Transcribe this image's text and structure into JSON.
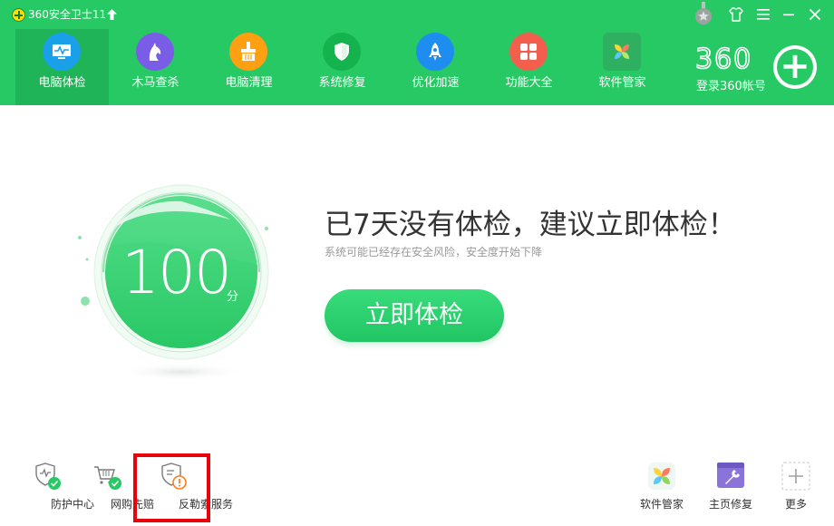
{
  "titlebar": {
    "app_title": "360安全卫士11"
  },
  "nav": {
    "items": [
      {
        "label": "电脑体检",
        "icon": "monitor-icon",
        "color": "#1aa0e8",
        "active": true
      },
      {
        "label": "木马查杀",
        "icon": "horse-icon",
        "color": "#7a5de6"
      },
      {
        "label": "电脑清理",
        "icon": "broom-icon",
        "color": "#ff9f12"
      },
      {
        "label": "系统修复",
        "icon": "shield-icon",
        "color": "#14b34e"
      },
      {
        "label": "优化加速",
        "icon": "rocket-icon",
        "color": "#1d8ef0"
      },
      {
        "label": "功能大全",
        "icon": "grid-icon",
        "color": "#f2604d"
      },
      {
        "label": "软件管家",
        "icon": "flower-icon",
        "color": "#2fb060"
      }
    ]
  },
  "account": {
    "brand": "360",
    "label": "登录360帐号"
  },
  "score": {
    "value": "100",
    "unit": "分"
  },
  "main": {
    "headline": "已7天没有体检，建议立即体检！",
    "subline": "系统可能已经存在安全风险，安全度开始下降",
    "check_button": "立即体检"
  },
  "tools_left": [
    {
      "label": "防护中心",
      "icon": "shield-check-icon"
    },
    {
      "label": "网购先赔",
      "icon": "cart-check-icon"
    },
    {
      "label": "反勒索服务",
      "icon": "shield-warning-icon"
    }
  ],
  "tools_right": [
    {
      "label": "软件管家",
      "icon": "flower-icon"
    },
    {
      "label": "主页修复",
      "icon": "wrench-icon"
    },
    {
      "label": "更多",
      "icon": "plus-icon"
    }
  ],
  "colors": {
    "brand_green": "#27c964",
    "highlight_red": "#e8030c"
  }
}
